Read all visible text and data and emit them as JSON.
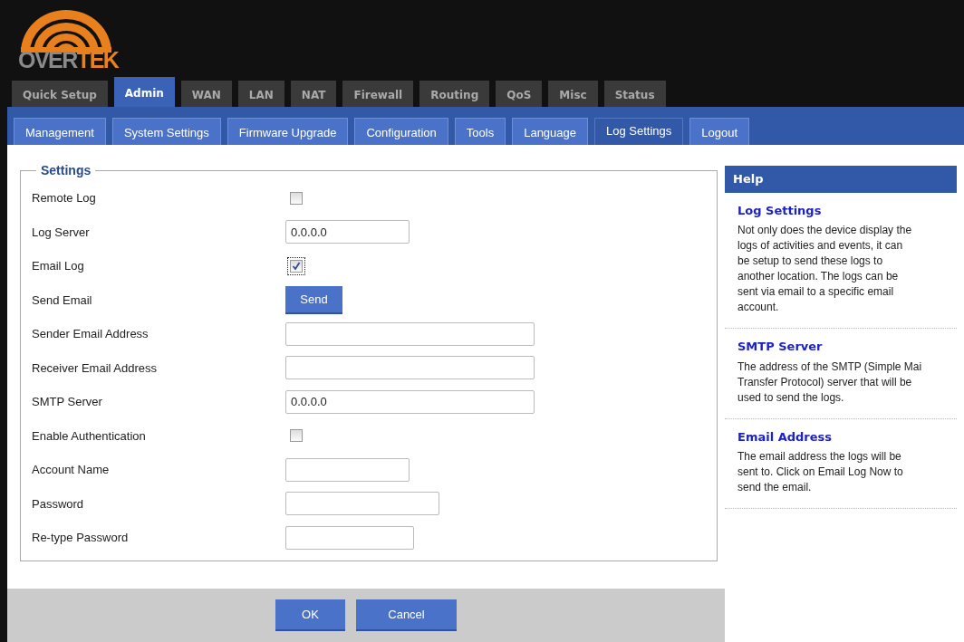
{
  "logo": {
    "text_dark": "OVER",
    "text_accent": "TEK"
  },
  "main_tabs": [
    {
      "label": "Quick Setup",
      "selected": false
    },
    {
      "label": "Admin",
      "selected": true
    },
    {
      "label": "WAN",
      "selected": false
    },
    {
      "label": "LAN",
      "selected": false
    },
    {
      "label": "NAT",
      "selected": false
    },
    {
      "label": "Firewall",
      "selected": false
    },
    {
      "label": "Routing",
      "selected": false
    },
    {
      "label": "QoS",
      "selected": false
    },
    {
      "label": "Misc",
      "selected": false
    },
    {
      "label": "Status",
      "selected": false
    }
  ],
  "sub_tabs": [
    {
      "label": "Management",
      "selected": false
    },
    {
      "label": "System Settings",
      "selected": false
    },
    {
      "label": "Firmware Upgrade",
      "selected": false
    },
    {
      "label": "Configuration",
      "selected": false
    },
    {
      "label": "Tools",
      "selected": false
    },
    {
      "label": "Language",
      "selected": false
    },
    {
      "label": "Log Settings",
      "selected": true
    },
    {
      "label": "Logout",
      "selected": false
    }
  ],
  "settings": {
    "legend": "Settings",
    "rows": [
      {
        "label": "Remote Log",
        "kind": "checkbox",
        "checked": false,
        "focused": false
      },
      {
        "label": "Log Server",
        "kind": "text",
        "value": "0.0.0.0"
      },
      {
        "label": "Email Log",
        "kind": "checkbox",
        "checked": true,
        "focused": true
      },
      {
        "label": "Send Email",
        "kind": "button",
        "button": "Send"
      },
      {
        "label": "Sender Email Address",
        "kind": "text"
      },
      {
        "label": "Receiver Email Address",
        "kind": "text"
      },
      {
        "label": "SMTP Server",
        "kind": "text",
        "value": "0.0.0.0"
      },
      {
        "label": "Enable Authentication",
        "kind": "checkbox",
        "checked": false,
        "focused": false
      },
      {
        "label": "Account Name",
        "kind": "text"
      },
      {
        "label": "Password",
        "kind": "password"
      },
      {
        "label": "Re-type Password",
        "kind": "password"
      }
    ]
  },
  "buttons": [
    "OK",
    "Cancel"
  ],
  "help": {
    "title": "Help",
    "sections": [
      {
        "heading": "Log Settings",
        "text": "Not only does the device display the\nlogs of activities and events, it can\nbe setup to send these logs to\nanother location. The logs can be\nsent via email to a specific email\naccount."
      },
      {
        "heading": "SMTP Server",
        "text": "The address of the SMTP (Simple Mai\nTransfer Protocol) server that will be\nused to send the logs."
      },
      {
        "heading": "Email Address",
        "text": "The email address the logs will be\nsent to. Click on Email Log Now to\nsend the email."
      }
    ]
  }
}
